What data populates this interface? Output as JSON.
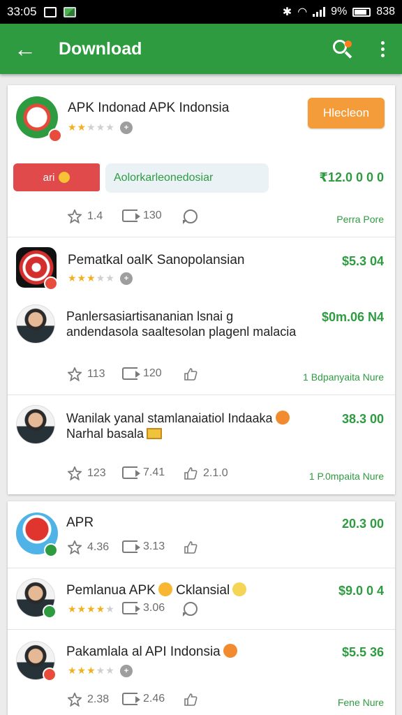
{
  "status_bar": {
    "time": "33:05",
    "battery": "9%",
    "clock_right": "838"
  },
  "app_bar": {
    "back_glyph": "←",
    "title": "Download"
  },
  "colors": {
    "brand_green": "#2e9b41",
    "accent_orange": "#f49b3a",
    "promo_red": "#e04a4a"
  },
  "card1": {
    "item1": {
      "name": "APK Indonad APK Indonsia",
      "stars": "★★",
      "stars_off": "★★★",
      "install_label": "Hlecleon",
      "promo_label": "ari",
      "pill_text": "Aolorkarleonedosiar",
      "price": "₹12.0 0 0 0",
      "likes": "1.4",
      "shares": "130",
      "meta": "Perra Pore"
    },
    "item2": {
      "name": "Pematkal oalK Sanopolansian",
      "stars": "★★★",
      "stars_off": "★★",
      "price": "$5.3 04"
    },
    "item3": {
      "desc": "Panlersasiartisananian lsnai g andendasola saaltesolan plagenl malacia",
      "price": "$0m.06 N4",
      "likes": "113",
      "shares": "120",
      "meta": "1 Bdpanyaita Nure"
    },
    "item4": {
      "desc_line1": "Wanilak yanal stamlanaiatiol Indaaka",
      "desc_line2": "Narhal basala",
      "price": "38.3 00",
      "likes": "123",
      "shares": "7.41",
      "thumbs": "2.1.0",
      "meta": "1 P.0mpaita Nure"
    }
  },
  "card2": {
    "item1": {
      "name": "APR",
      "price": "20.3 00",
      "likes": "4.36",
      "shares": "3.13"
    },
    "item2": {
      "name": "Pemlanua APK",
      "name_suffix": "Cklansial",
      "stars": "★★★★",
      "stars_off": "★",
      "shares": "3.06",
      "price": "$9.0 0 4"
    },
    "item3": {
      "name": "Pakamlala al API Indonsia",
      "stars": "★★★",
      "stars_off": "★★",
      "price": "$5.5 36",
      "likes": "2.38",
      "shares": "2.46",
      "meta": "Fene Nure"
    }
  }
}
